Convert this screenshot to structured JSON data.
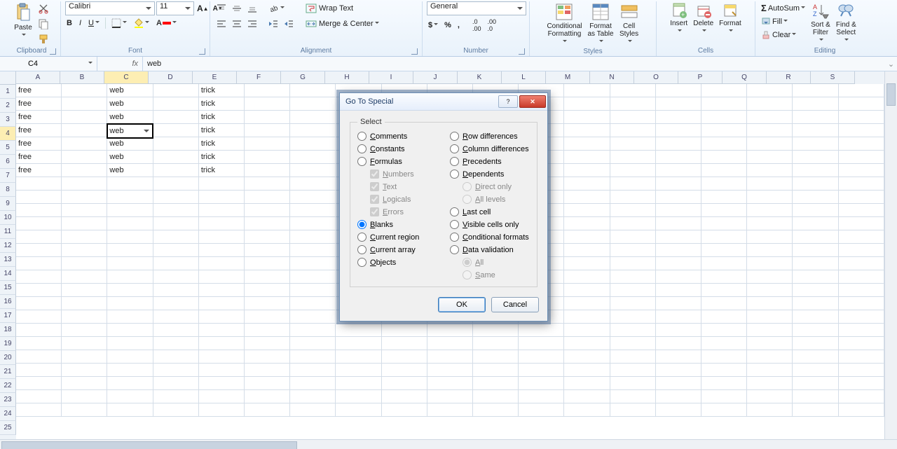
{
  "ribbon": {
    "clipboard": {
      "title": "Clipboard",
      "paste": "Paste"
    },
    "font": {
      "title": "Font",
      "name": "Calibri",
      "size": "11"
    },
    "alignment": {
      "title": "Alignment",
      "wrap": "Wrap Text",
      "merge": "Merge & Center"
    },
    "number": {
      "title": "Number",
      "format": "General"
    },
    "styles": {
      "title": "Styles",
      "cond": "Conditional\nFormatting",
      "table": "Format\nas Table",
      "cell": "Cell\nStyles"
    },
    "cells": {
      "title": "Cells",
      "insert": "Insert",
      "delete": "Delete",
      "format": "Format"
    },
    "editing": {
      "title": "Editing",
      "autosum": "AutoSum",
      "fill": "Fill",
      "clear": "Clear",
      "sort": "Sort &\nFilter",
      "find": "Find &\nSelect"
    }
  },
  "formula_bar": {
    "cell_ref": "C4",
    "fx": "fx",
    "value": "web"
  },
  "columns": [
    "A",
    "B",
    "C",
    "D",
    "E",
    "F",
    "G",
    "H",
    "I",
    "J",
    "K",
    "L",
    "M",
    "N",
    "O",
    "P",
    "Q",
    "R",
    "S"
  ],
  "data_rows": [
    {
      "n": 1,
      "A": "free",
      "C": "web",
      "E": "trick"
    },
    {
      "n": 2,
      "A": "free",
      "C": "web",
      "E": "trick"
    },
    {
      "n": 3,
      "A": "free",
      "C": "web",
      "E": "trick"
    },
    {
      "n": 4,
      "A": "free",
      "C": "web",
      "E": "trick"
    },
    {
      "n": 5,
      "A": "free",
      "C": "web",
      "E": "trick"
    },
    {
      "n": 6,
      "A": "free",
      "C": "web",
      "E": "trick"
    },
    {
      "n": 7,
      "A": "free",
      "C": "web",
      "E": "trick"
    }
  ],
  "visible_row_count": 25,
  "active": {
    "col": "C",
    "row": 4
  },
  "dialog": {
    "title": "Go To Special",
    "legend": "Select",
    "left": [
      {
        "id": "comments",
        "label": "Comments",
        "type": "radio",
        "checked": false
      },
      {
        "id": "constants",
        "label": "Constants",
        "type": "radio",
        "checked": false
      },
      {
        "id": "formulas",
        "label": "Formulas",
        "type": "radio",
        "checked": false
      },
      {
        "id": "numbers",
        "label": "Numbers",
        "type": "check",
        "checked": true,
        "disabled": true,
        "sub": true
      },
      {
        "id": "text",
        "label": "Text",
        "type": "check",
        "checked": true,
        "disabled": true,
        "sub": true
      },
      {
        "id": "logicals",
        "label": "Logicals",
        "type": "check",
        "checked": true,
        "disabled": true,
        "sub": true
      },
      {
        "id": "errors",
        "label": "Errors",
        "type": "check",
        "checked": true,
        "disabled": true,
        "sub": true
      },
      {
        "id": "blanks",
        "label": "Blanks",
        "type": "radio",
        "checked": true
      },
      {
        "id": "curregion",
        "label": "Current region",
        "type": "radio",
        "checked": false
      },
      {
        "id": "curarray",
        "label": "Current array",
        "type": "radio",
        "checked": false
      },
      {
        "id": "objects",
        "label": "Objects",
        "type": "radio",
        "checked": false
      }
    ],
    "right": [
      {
        "id": "rowdiff",
        "label": "Row differences",
        "type": "radio",
        "checked": false
      },
      {
        "id": "coldiff",
        "label": "Column differences",
        "type": "radio",
        "checked": false
      },
      {
        "id": "precedents",
        "label": "Precedents",
        "type": "radio",
        "checked": false
      },
      {
        "id": "dependents",
        "label": "Dependents",
        "type": "radio",
        "checked": false
      },
      {
        "id": "direct",
        "label": "Direct only",
        "type": "radio",
        "checked": true,
        "disabled": true,
        "sub": true
      },
      {
        "id": "alllevels",
        "label": "All levels",
        "type": "radio",
        "checked": false,
        "disabled": true,
        "sub": true
      },
      {
        "id": "lastcell",
        "label": "Last cell",
        "type": "radio",
        "checked": false
      },
      {
        "id": "visible",
        "label": "Visible cells only",
        "type": "radio",
        "checked": false
      },
      {
        "id": "condfmt",
        "label": "Conditional formats",
        "type": "radio",
        "checked": false
      },
      {
        "id": "datavalidation",
        "label": "Data validation",
        "type": "radio",
        "checked": false
      },
      {
        "id": "all",
        "label": "All",
        "type": "radio",
        "checked": true,
        "disabled": true,
        "sub": true
      },
      {
        "id": "same",
        "label": "Same",
        "type": "radio",
        "checked": false,
        "disabled": true,
        "sub": true
      }
    ],
    "ok": "OK",
    "cancel": "Cancel",
    "help": "?"
  }
}
